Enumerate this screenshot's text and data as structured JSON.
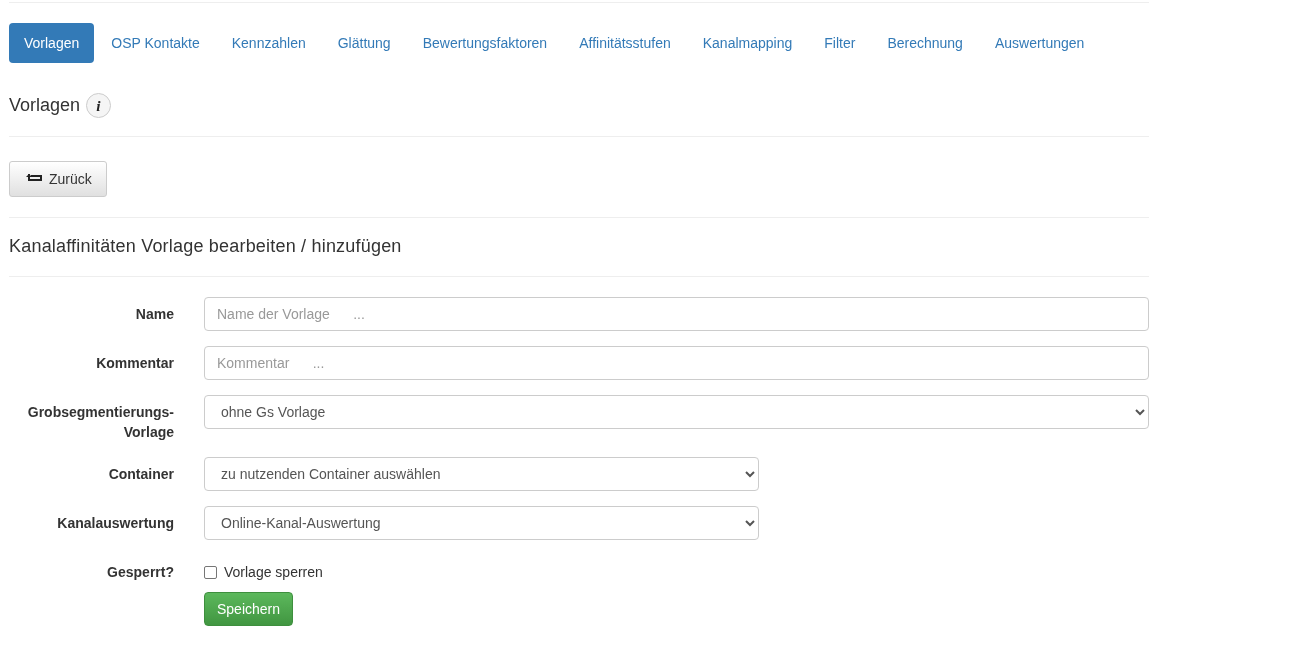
{
  "tabs": [
    {
      "label": "Vorlagen",
      "selected": true
    },
    {
      "label": "OSP Kontakte",
      "selected": false
    },
    {
      "label": "Kennzahlen",
      "selected": false
    },
    {
      "label": "Glättung",
      "selected": false
    },
    {
      "label": "Bewertungsfaktoren",
      "selected": false
    },
    {
      "label": "Affinitätsstufen",
      "selected": false
    },
    {
      "label": "Kanalmapping",
      "selected": false
    },
    {
      "label": "Filter",
      "selected": false
    },
    {
      "label": "Berechnung",
      "selected": false
    },
    {
      "label": "Auswertungen",
      "selected": false
    }
  ],
  "page_title": "Vorlagen",
  "info_icon": "i",
  "back_button": "Zurück",
  "form_title": "Kanalaffinitäten Vorlage bearbeiten / hinzufügen",
  "fields": [
    {
      "kind": "text",
      "label": "Name",
      "placeholder": "Name der Vorlage      ..."
    },
    {
      "kind": "text",
      "label": "Kommentar",
      "placeholder": "Kommentar      ..."
    },
    {
      "kind": "select",
      "label": "Grobsegmentierungs-Vorlage",
      "value": "ohne Gs Vorlage",
      "wide": true
    },
    {
      "kind": "select",
      "label": "Container",
      "value": "zu nutzenden Container auswählen",
      "wide": false
    },
    {
      "kind": "select",
      "label": "Kanalauswertung",
      "value": "Online-Kanal-Auswertung",
      "wide": false
    },
    {
      "kind": "checkbox",
      "label": "Gesperrt?",
      "text": "Vorlage sperren",
      "checked": false
    }
  ],
  "save_button": "Speichern"
}
